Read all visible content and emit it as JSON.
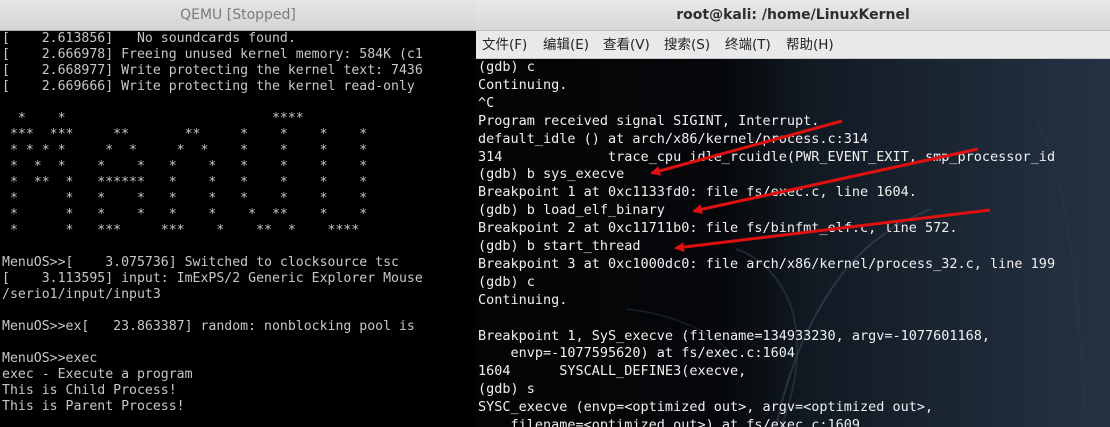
{
  "qemu": {
    "title": "QEMU [Stopped]",
    "lines": [
      "[    2.613856]   No soundcards found.",
      "[    2.666978] Freeing unused kernel memory: 584K (c1",
      "[    2.668977] Write protecting the kernel text: 7436",
      "[    2.669666] Write protecting the kernel read-only",
      "",
      "  *    *                          ****",
      " ***  ***     **       **     *    *    *    *",
      " * * * *     *  *     *  *    *    *    *    *",
      " *  *  *    *    *   *    *   *    *    *    *",
      " *  **  *   ******   *    *   *    *    *    *",
      " *      *   *    *   *    *   *    *    *    *",
      " *      *   *    *   *    *    *  **    *    *",
      " *      *   ***     ***    *    **  *    ****",
      "",
      "MenuOS>>[    3.075736] Switched to clocksource tsc",
      "[    3.113595] input: ImExPS/2 Generic Explorer Mouse",
      "/serio1/input/input3",
      "",
      "MenuOS>>ex[   23.863387] random: nonblocking pool is",
      "",
      "MenuOS>>exec",
      "exec - Execute a program",
      "This is Child Process!",
      "This is Parent Process!"
    ]
  },
  "terminal": {
    "title": "root@kali: /home/LinuxKernel",
    "menu": [
      {
        "id": "file",
        "label": "文件(F)"
      },
      {
        "id": "edit",
        "label": "编辑(E)"
      },
      {
        "id": "view",
        "label": "查看(V)"
      },
      {
        "id": "search",
        "label": "搜索(S)"
      },
      {
        "id": "terminal",
        "label": "终端(T)"
      },
      {
        "id": "help",
        "label": "帮助(H)"
      }
    ],
    "lines": [
      "(gdb) c",
      "Continuing.",
      "^C",
      "Program received signal SIGINT, Interrupt.",
      "default_idle () at arch/x86/kernel/process.c:314",
      "314             trace_cpu_idle_rcuidle(PWR_EVENT_EXIT, smp_processor_id",
      "(gdb) b sys_execve",
      "Breakpoint 1 at 0xc1133fd0: file fs/exec.c, line 1604.",
      "(gdb) b load_elf_binary",
      "Breakpoint 2 at 0xc11711b0: file fs/binfmt_elf.c, line 572.",
      "(gdb) b start_thread",
      "Breakpoint 3 at 0xc1000dc0: file arch/x86/kernel/process_32.c, line 199",
      "(gdb) c",
      "Continuing.",
      "",
      "Breakpoint 1, SyS_execve (filename=134933230, argv=-1077601168,",
      "    envp=-1077595620) at fs/exec.c:1604",
      "1604      SYSCALL_DEFINE3(execve,",
      "(gdb) s",
      "SYSC_execve (envp=<optimized out>, argv=<optimized out>,",
      "    filename=<optimized out>) at fs/exec.c:1609"
    ]
  },
  "colors": {
    "annotation_arrow": "#e01010",
    "terminal_text": "#f0f0f0",
    "qemu_text": "#c7c7c7"
  }
}
